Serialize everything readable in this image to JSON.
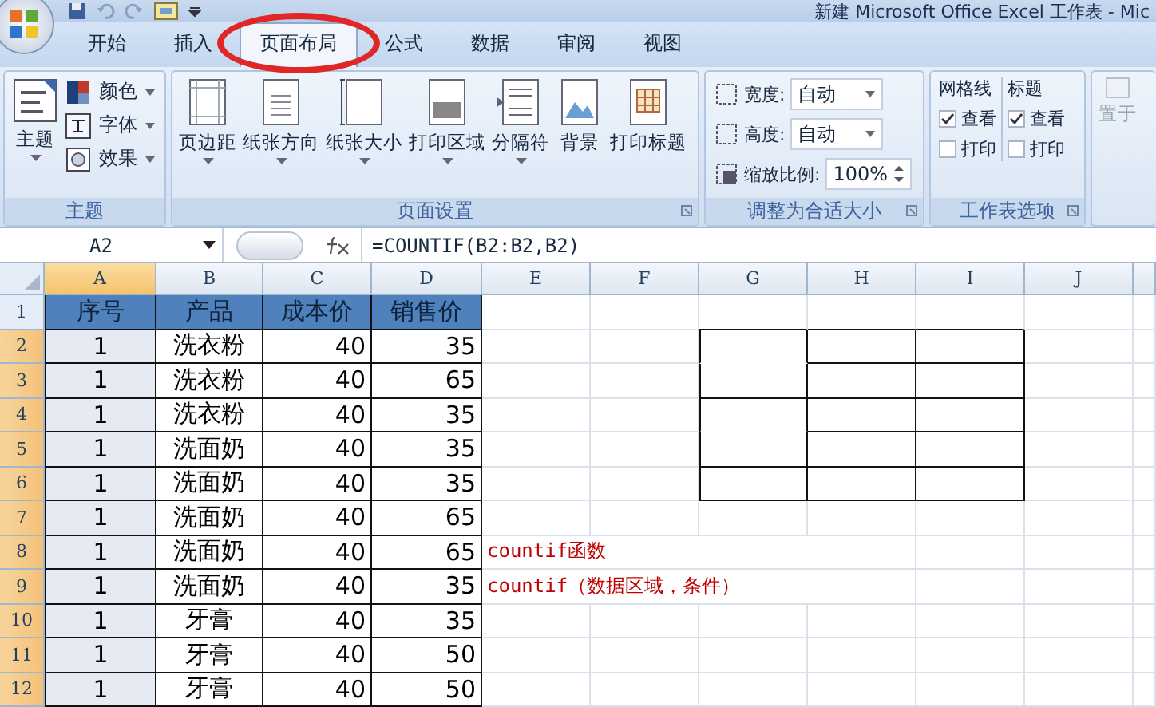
{
  "window": {
    "title": "新建 Microsoft Office Excel 工作表 - Mic"
  },
  "tabs": [
    {
      "label": "开始",
      "selected": false
    },
    {
      "label": "插入",
      "selected": false
    },
    {
      "label": "页面布局",
      "selected": true
    },
    {
      "label": "公式",
      "selected": false
    },
    {
      "label": "数据",
      "selected": false
    },
    {
      "label": "审阅",
      "selected": false
    },
    {
      "label": "视图",
      "selected": false
    }
  ],
  "theme_group": {
    "title": "主题",
    "main_button": "主题",
    "items": [
      "颜色",
      "字体",
      "效果"
    ]
  },
  "page_setup_group": {
    "title": "页面设置",
    "buttons": [
      {
        "label": "页边距",
        "dropdown": true
      },
      {
        "label": "纸张方向",
        "dropdown": true
      },
      {
        "label": "纸张大小",
        "dropdown": true
      },
      {
        "label": "打印区域",
        "dropdown": true
      },
      {
        "label": "分隔符",
        "dropdown": true
      },
      {
        "label": "背景",
        "dropdown": false
      },
      {
        "label": "打印标题",
        "dropdown": false
      }
    ]
  },
  "scale_group": {
    "title": "调整为合适大小",
    "fields": [
      {
        "label": "宽度:",
        "value": "自动",
        "kind": "dropdown"
      },
      {
        "label": "高度:",
        "value": "自动",
        "kind": "dropdown"
      },
      {
        "label": "缩放比例:",
        "value": "100%",
        "kind": "spinner"
      }
    ]
  },
  "sheet_options_group": {
    "title": "工作表选项",
    "sections": [
      {
        "title": "网格线",
        "options": [
          {
            "label": "查看",
            "checked": true
          },
          {
            "label": "打印",
            "checked": false
          }
        ]
      },
      {
        "title": "标题",
        "options": [
          {
            "label": "查看",
            "checked": true
          },
          {
            "label": "打印",
            "checked": false
          }
        ]
      }
    ]
  },
  "arrange_group": {
    "label": "置于",
    "disabled": true
  },
  "formula_bar": {
    "name_box": "A2",
    "formula": "=COUNTIF(B2:B2,B2)"
  },
  "sheet": {
    "columns": [
      {
        "label": "A",
        "selected": true
      },
      {
        "label": "B",
        "selected": false
      },
      {
        "label": "C",
        "selected": false
      },
      {
        "label": "D",
        "selected": false
      },
      {
        "label": "E",
        "selected": false
      },
      {
        "label": "F",
        "selected": false
      },
      {
        "label": "G",
        "selected": false
      },
      {
        "label": "H",
        "selected": false
      },
      {
        "label": "I",
        "selected": false
      },
      {
        "label": "J",
        "selected": false
      }
    ],
    "rows": [
      {
        "label": "1",
        "selected": false,
        "kind": "header",
        "cells": [
          "序号",
          "产品",
          "成本价",
          "销售价"
        ]
      },
      {
        "label": "2",
        "selected": true,
        "kind": "data",
        "cells": [
          "1",
          "洗衣粉",
          "40",
          "35"
        ]
      },
      {
        "label": "3",
        "selected": true,
        "kind": "data",
        "cells": [
          "1",
          "洗衣粉",
          "40",
          "65"
        ]
      },
      {
        "label": "4",
        "selected": true,
        "kind": "data",
        "cells": [
          "1",
          "洗衣粉",
          "40",
          "35"
        ]
      },
      {
        "label": "5",
        "selected": true,
        "kind": "data",
        "cells": [
          "1",
          "洗面奶",
          "40",
          "35"
        ]
      },
      {
        "label": "6",
        "selected": true,
        "kind": "data",
        "cells": [
          "1",
          "洗面奶",
          "40",
          "35"
        ]
      },
      {
        "label": "7",
        "selected": true,
        "kind": "data",
        "cells": [
          "1",
          "洗面奶",
          "40",
          "65"
        ]
      },
      {
        "label": "8",
        "selected": true,
        "kind": "data",
        "cells": [
          "1",
          "洗面奶",
          "40",
          "65"
        ],
        "note": "countif函数"
      },
      {
        "label": "9",
        "selected": true,
        "kind": "data",
        "cells": [
          "1",
          "洗面奶",
          "40",
          "35"
        ],
        "note": "countif（数据区域，条件）"
      },
      {
        "label": "10",
        "selected": true,
        "kind": "data",
        "cells": [
          "1",
          "牙膏",
          "40",
          "35"
        ]
      },
      {
        "label": "11",
        "selected": true,
        "kind": "data",
        "cells": [
          "1",
          "牙膏",
          "40",
          "50"
        ]
      },
      {
        "label": "12",
        "selected": true,
        "kind": "data",
        "cells": [
          "1",
          "牙膏",
          "40",
          "50"
        ]
      }
    ]
  }
}
